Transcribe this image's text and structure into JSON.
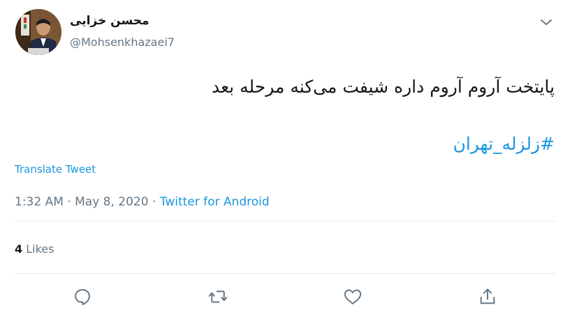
{
  "author": {
    "display_name": "محسن خزایی",
    "handle": "@Mohsenkhazaei7"
  },
  "tweet": {
    "text": "پایتخت آروم آروم داره شیفت می‌کنه مرحله بعد",
    "hashtag": "#زلزله_تهران",
    "translate_label": "Translate Tweet",
    "time": "1:32 AM",
    "date": "May 8, 2020",
    "separator": "·",
    "source": "Twitter for Android"
  },
  "stats": {
    "likes_count": "4",
    "likes_label": "Likes"
  },
  "icons": {
    "menu": "chevron-down-icon",
    "reply": "reply-icon",
    "retweet": "retweet-icon",
    "like": "heart-icon",
    "share": "share-icon"
  },
  "colors": {
    "link": "#1b95e0",
    "secondary_text": "#657786",
    "primary_text": "#14171a",
    "divider": "#e1e8ed"
  }
}
